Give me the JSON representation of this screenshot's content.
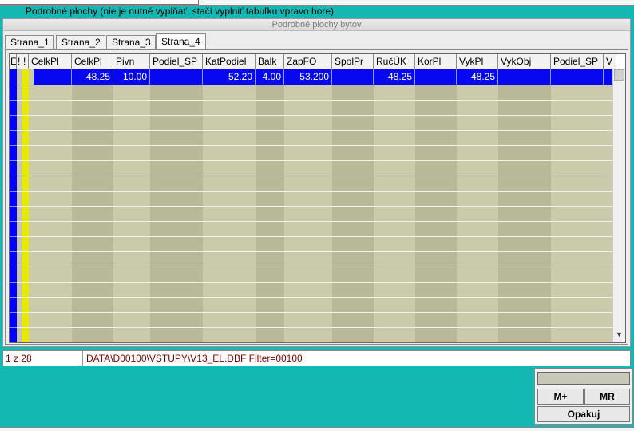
{
  "hint": "Podrobné plochy (nie je nutné vyplňať, stačí vyplniť tabuľku vpravo hore)",
  "panel_title": "Podrobné plochy bytov",
  "tabs": [
    "Strana_1",
    "Strana_2",
    "Strana_3",
    "Strana_4"
  ],
  "active_tab": "Strana_4",
  "columns": [
    "E",
    "!",
    "!",
    "CelkPl",
    "CelkPl",
    "Pivn",
    "Podiel_SP",
    "KatPodiel",
    "Balk",
    "ZapFO",
    "SpolPr",
    "RučÚK",
    "KorPl",
    "VykPl",
    "VykObj",
    "Podiel_SP",
    "V"
  ],
  "selected_row": [
    "",
    "",
    "",
    "",
    "48.25",
    "10.00",
    "",
    "52.20",
    "4.00",
    "53.200",
    "",
    "48.25",
    "",
    "48.25",
    "",
    "",
    ""
  ],
  "status": {
    "record": "1 z 28",
    "path": "DATA\\D00100\\VSTUPY\\V13_EL.DBF Filter=00100"
  },
  "calculator": {
    "mplus": "M+",
    "mr": "MR",
    "repeat": "Opakuj"
  },
  "colors": {
    "background": "#14b8b3",
    "selection": "#0808f0",
    "column_a": "#cbcbab",
    "column_b": "#b9b99a",
    "indicator_blue": "#0000ff",
    "indicator_yellow": "#e8e800"
  },
  "icons": {
    "scroll_up": "chevron-up-icon",
    "scroll_down": "chevron-down-icon"
  }
}
